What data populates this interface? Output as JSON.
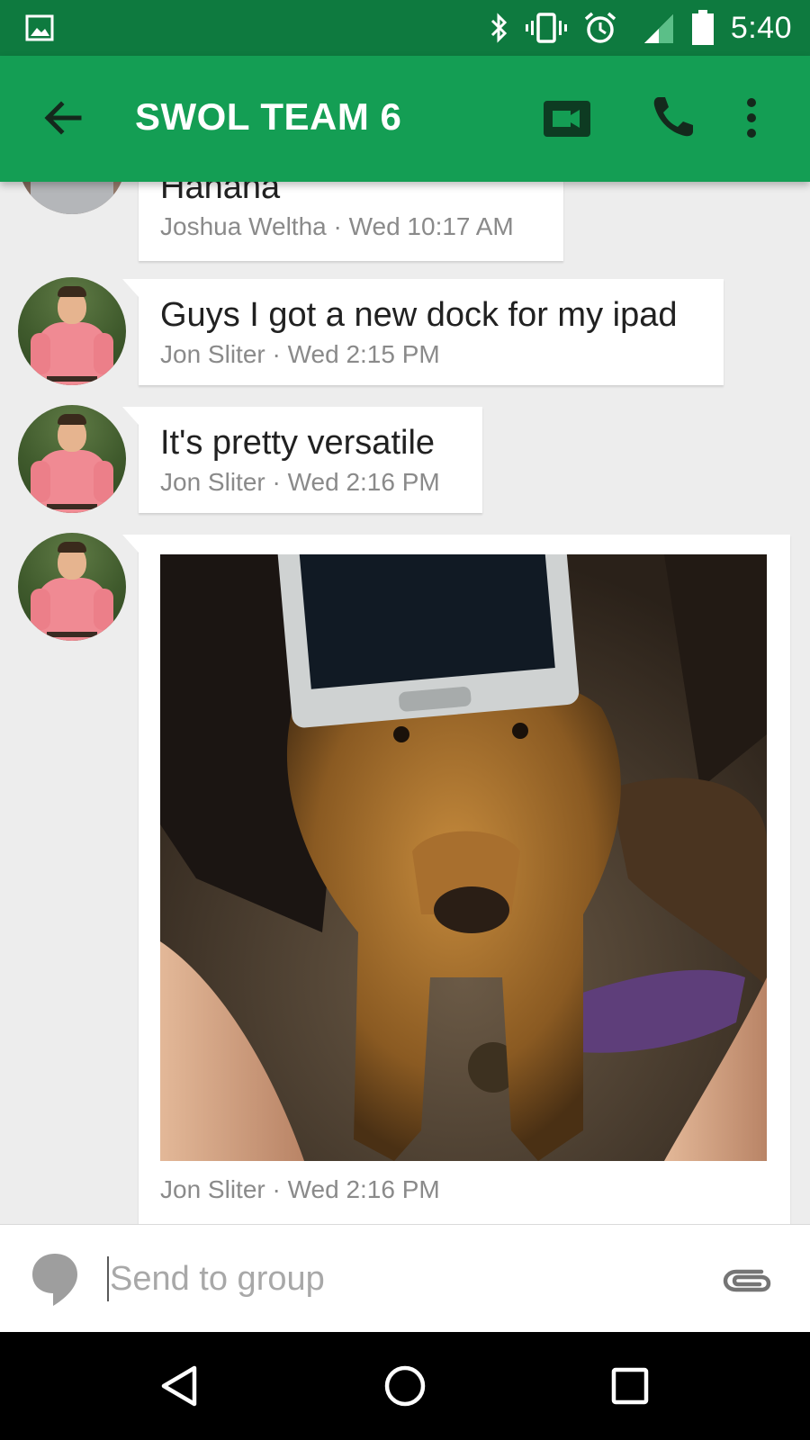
{
  "status_bar": {
    "time": "5:40",
    "network": "LTE",
    "icons": [
      "image-notification-icon",
      "bluetooth-icon",
      "vibrate-icon",
      "alarm-icon",
      "lte-signal-icon",
      "battery-icon"
    ]
  },
  "app_bar": {
    "title": "SWOL TEAM 6",
    "icons": [
      "back-arrow-icon",
      "video-call-icon",
      "phone-icon",
      "more-vert-icon"
    ]
  },
  "messages": [
    {
      "text": "Hahaha",
      "sender": "Joshua Weltha",
      "time": "Wed 10:17 AM",
      "meta": "Joshua Weltha · Wed 10:17 AM"
    },
    {
      "text": "Guys I got a new dock for my ipad",
      "sender": "Jon Sliter",
      "time": "Wed 2:15 PM",
      "meta": "Jon Sliter · Wed 2:15 PM"
    },
    {
      "text": "It's pretty versatile",
      "sender": "Jon Sliter",
      "time": "Wed 2:16 PM",
      "meta": "Jon Sliter · Wed 2:16 PM"
    },
    {
      "text": "",
      "sender": "Jon Sliter",
      "time": "Wed 2:16 PM",
      "meta": "Jon Sliter · Wed 2:16 PM",
      "attachment": "photo"
    }
  ],
  "composer": {
    "placeholder": "Send to group",
    "value": ""
  },
  "colors": {
    "status_bar": "#0e7a3f",
    "app_bar": "#149e54",
    "background": "#ededed",
    "bubble": "#ffffff"
  }
}
